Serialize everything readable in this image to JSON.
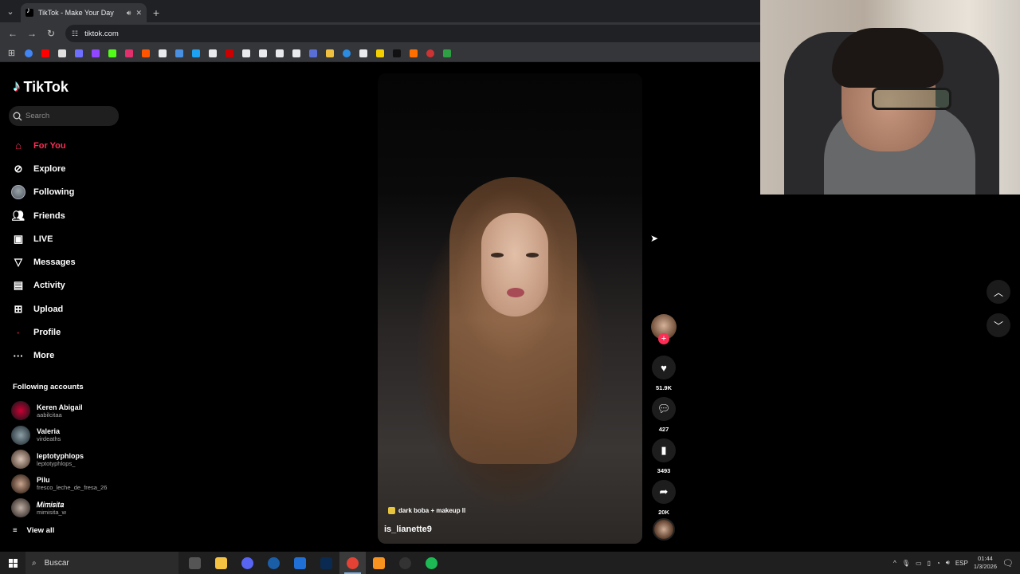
{
  "browser": {
    "tab_title": "TikTok - Make Your Day",
    "url": "tiktok.com",
    "bookmarks": [
      "google",
      "youtube",
      "bookmark-3",
      "bookmark-4",
      "twitch",
      "kick",
      "instagram",
      "soundcloud",
      "x",
      "bookmark-10",
      "bookmark-11",
      "bookmark-12",
      "bookmark-13",
      "bookmark-14",
      "bookmark-15",
      "notion",
      "bookmark-17",
      "bookmark-18",
      "bookmark-19",
      "bookmark-20",
      "bookmark-21",
      "bookmark-22",
      "bookmark-23",
      "bookmark-24",
      "bookmark-25",
      "bookmark-26"
    ]
  },
  "tiktok": {
    "logo_text": "TikTok",
    "search_placeholder": "Search",
    "nav": [
      {
        "label": "For You",
        "icon": "home-icon",
        "active": true
      },
      {
        "label": "Explore",
        "icon": "compass-icon"
      },
      {
        "label": "Following",
        "icon": "avatar-icon"
      },
      {
        "label": "Friends",
        "icon": "friends-icon"
      },
      {
        "label": "LIVE",
        "icon": "live-icon"
      },
      {
        "label": "Messages",
        "icon": "send-icon"
      },
      {
        "label": "Activity",
        "icon": "inbox-icon"
      },
      {
        "label": "Upload",
        "icon": "plus-box-icon"
      },
      {
        "label": "Profile",
        "icon": "profile-icon"
      },
      {
        "label": "More",
        "icon": "more-icon"
      }
    ],
    "following_header": "Following accounts",
    "following_accounts": [
      {
        "name": "Keren Abigail",
        "username": "aabilcitaa"
      },
      {
        "name": "Valeria",
        "username": "virdeaths"
      },
      {
        "name": "leptotyphlops",
        "username": "leptotyphlops_"
      },
      {
        "name": "Pilu",
        "username": "fresco_leche_de_fresa_26"
      },
      {
        "name": "𝑀𝑖𝑚𝑖𝑠𝑖𝑡𝑎",
        "username": "mimisita_w"
      }
    ],
    "view_all": "View all",
    "video": {
      "author": "is_lianette9",
      "sound": "dark boba + makeup ll",
      "likes": "51.9K",
      "comments": "427",
      "saves": "3493",
      "shares": "20K"
    }
  },
  "taskbar": {
    "search_placeholder": "Buscar",
    "language": "ESP",
    "time": "01:44",
    "date": "1/3/2026"
  }
}
